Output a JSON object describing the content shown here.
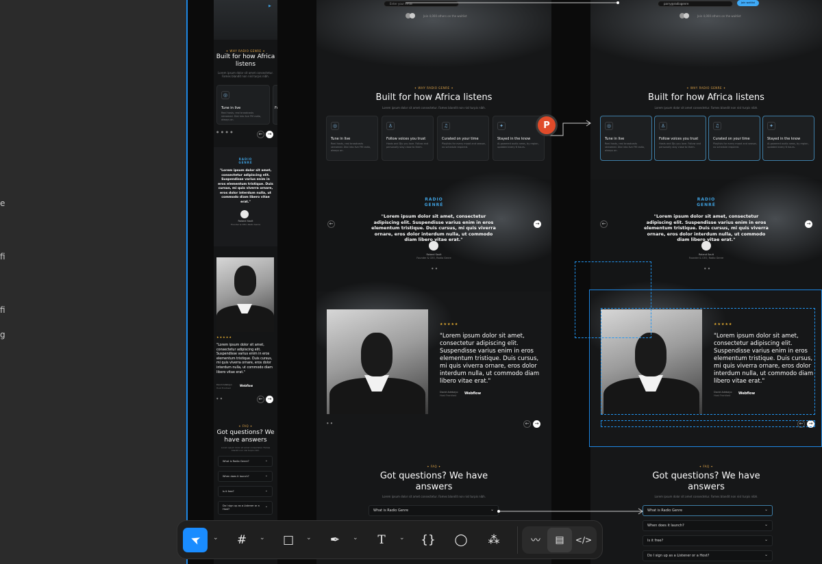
{
  "left_panel": {
    "edge_letters": [
      "e",
      "fi",
      "fi",
      "g"
    ]
  },
  "top": {
    "email_placeholder": "Enter your email",
    "email_value": "parry@radiogenre",
    "join_text": "Join 4,000 others on the waitlist",
    "join_button": "Join waitlist"
  },
  "why": {
    "eyebrow": "✦ WHY RADIO GENRE ✦",
    "title": "Built for how Africa listens",
    "subtitle": "Lorem ipsum dolor sit amet consectetur. Fames blandit non nisl turpis nibh.",
    "cards": [
      {
        "icon": "◎",
        "icon_name": "radio-icon",
        "title": "Tune in live",
        "text": "Real hosts, real broadcasts streamed. Dial into live FM radio, always on."
      },
      {
        "icon": "♙",
        "icon_name": "user-icon",
        "title": "Follow voices you trust",
        "text": "Hosts and DJs you love. Follow and personally stay close to them."
      },
      {
        "icon": "♫",
        "icon_name": "playlist-icon",
        "title": "Curated on your time",
        "text": "Playlists for every mood and season, no schedule required."
      },
      {
        "icon": "✦",
        "icon_name": "sparkle-icon",
        "title": "Stayed in the know",
        "text": "AI-powered audio news, by region, updated every 6 hours."
      }
    ]
  },
  "founder": {
    "logo_line1": "RADIO",
    "logo_line2": "GENRÉ",
    "quote": "\"Lorem ipsum dolor sit amet, consectetur adipiscing elit. Suspendisse varius enim in eros elementum tristique. Duis cursus, mi quis viverra ornare, eros dolor interdum nulla, ut commodo diam libero vitae erat.\"",
    "name": "Roland Sault",
    "role": "Founder & CEO, Radio Genre",
    "dots": "● ●"
  },
  "testimonial": {
    "stars": "★★★★★",
    "quote": "\"Lorem ipsum dolor sit amet, consectetur adipiscing elit. Suspendisse varius enim in eros elementum tristique. Duis cursus, mi quis viverra ornare, eros dolor interdum nulla, ut commodo diam libero vitae erat.\"",
    "name": "David Adebayo",
    "role": "Host Frontlast",
    "company": "Webflow",
    "dots": "● ●"
  },
  "faq": {
    "eyebrow": "✦ FAQ ✦",
    "title_line1": "Got questions? We have",
    "title_line2": "answers",
    "mobile_title_line1": "Got questions? We",
    "mobile_title_line2": "have answers",
    "subtitle": "Lorem ipsum dolor sit amet consectetur. Fames blandit non nisl turpis nibh.",
    "items": [
      "What is Radio Genre",
      "When does it launch?",
      "Is it free?",
      "Do I sign up as a Listener or a Host?"
    ],
    "mobile_items": [
      "What is Radio Genre?",
      "When does it launch?",
      "Is it free?",
      "Do I sign up as a Listener or a Host?"
    ]
  },
  "mobile": {
    "why_title_line1": "Built for how Africa",
    "why_title_line2": "listens"
  },
  "comment_badge": "P",
  "arrows": {
    "prev": "←",
    "next": "→"
  },
  "chevron": "⌄",
  "toolbar": {
    "tools": [
      {
        "name": "move-tool",
        "glyph": "➤"
      },
      {
        "name": "frame-tool",
        "glyph": "#"
      },
      {
        "name": "shape-tool",
        "glyph": "□"
      },
      {
        "name": "pen-tool",
        "glyph": "✒"
      },
      {
        "name": "text-tool",
        "glyph": "T"
      },
      {
        "name": "variables-tool",
        "glyph": "{}"
      },
      {
        "name": "comment-tool",
        "glyph": "◯"
      },
      {
        "name": "actions-tool",
        "glyph": "⁂"
      }
    ],
    "modes": [
      {
        "name": "draw-mode",
        "glyph": "〰"
      },
      {
        "name": "design-mode",
        "glyph": "▤"
      },
      {
        "name": "dev-mode",
        "glyph": "</>"
      }
    ],
    "caret": "⌄",
    "accent": "#1a8cff"
  }
}
